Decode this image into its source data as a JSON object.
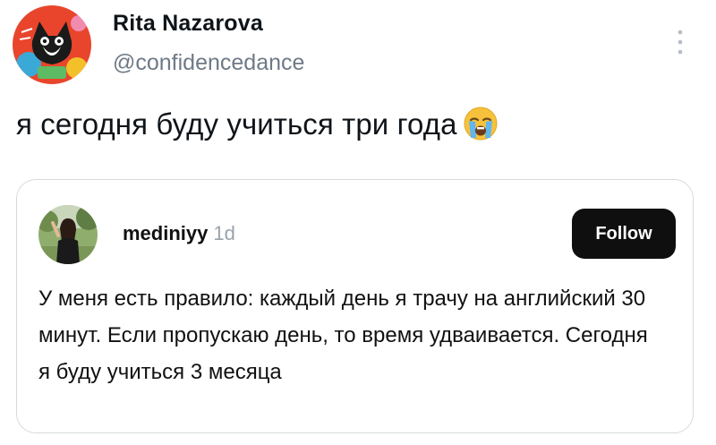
{
  "author": {
    "display_name": "Rita Nazarova",
    "handle": "@confidencedance"
  },
  "tweet": {
    "text": "я сегодня буду учиться три года",
    "emoji": "loudly-crying-face"
  },
  "quoted_post": {
    "username": "mediniyy",
    "time_ago": "1d",
    "follow_label": "Follow",
    "body": "У меня есть правило: каждый день я трачу на английский 30 минут. Если пропускаю день, то время удваивается. Сегодня я буду учиться 3 месяца"
  },
  "colors": {
    "secondary_text": "#6e7a86",
    "follow_bg": "#0f0f0f",
    "card_border": "#d6dadd"
  }
}
